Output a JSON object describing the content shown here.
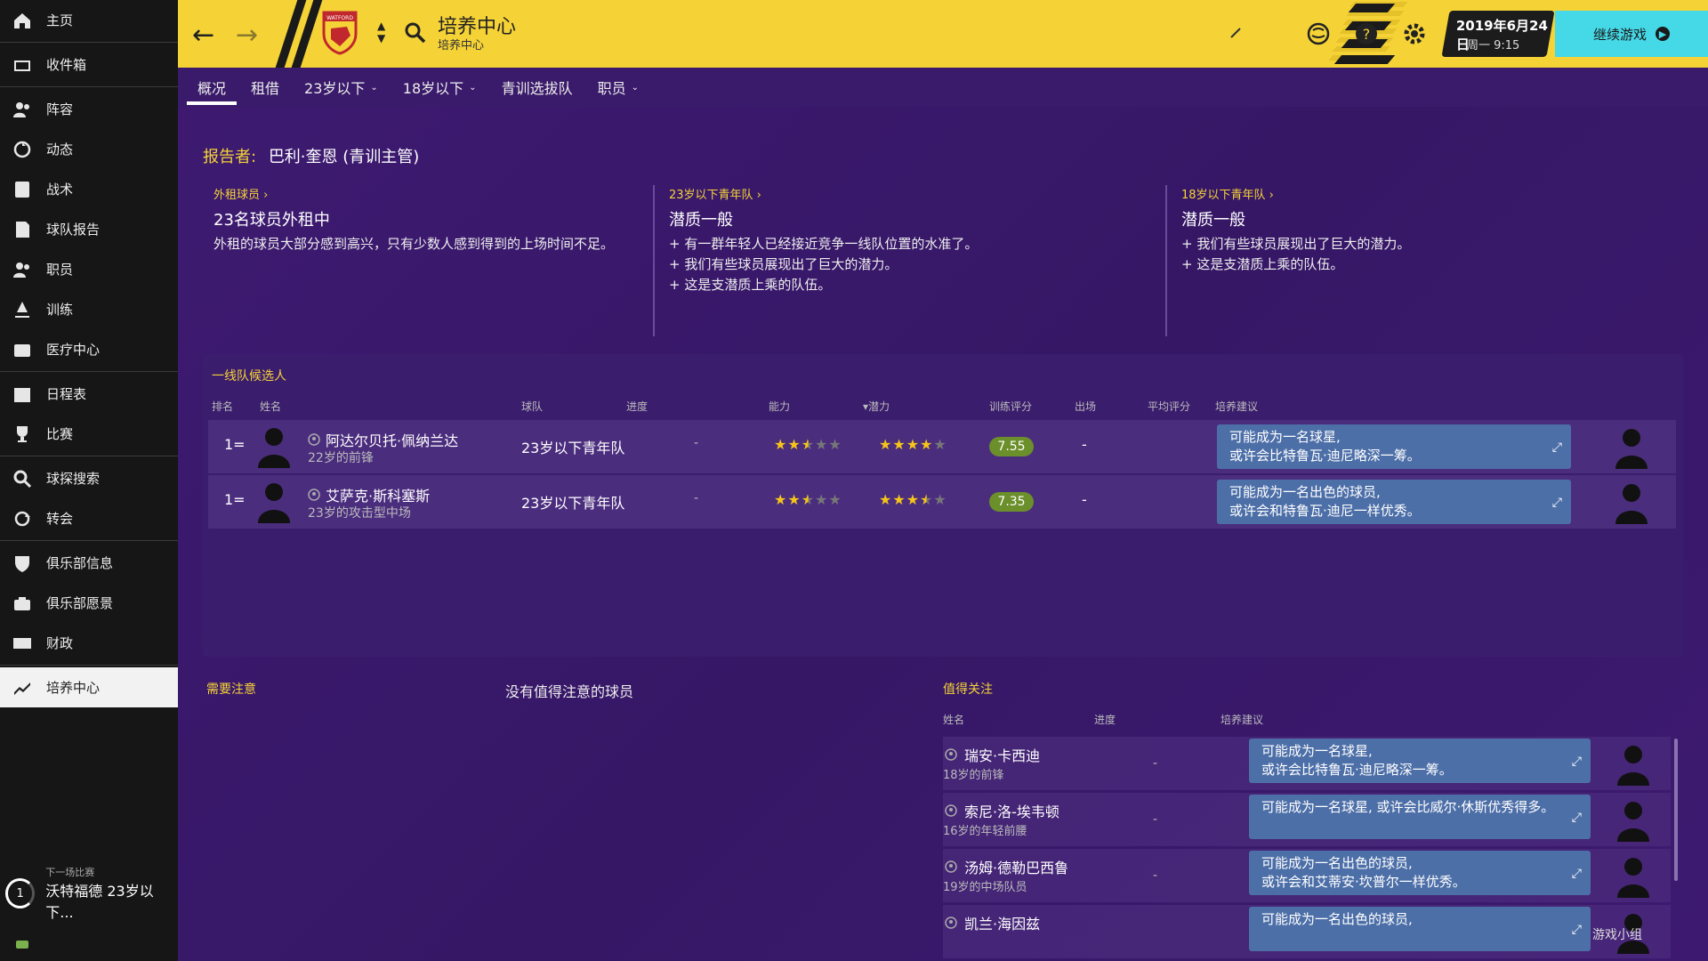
{
  "sidebar": {
    "items": [
      {
        "label": "主页",
        "icon": "home-icon"
      },
      {
        "label": "收件箱",
        "icon": "inbox-icon"
      },
      {
        "label": "阵容",
        "icon": "squad-icon"
      },
      {
        "label": "动态",
        "icon": "dynamics-icon"
      },
      {
        "label": "战术",
        "icon": "tactics-icon"
      },
      {
        "label": "球队报告",
        "icon": "report-icon"
      },
      {
        "label": "职员",
        "icon": "staff-icon"
      },
      {
        "label": "训练",
        "icon": "training-icon"
      },
      {
        "label": "医疗中心",
        "icon": "medical-icon"
      },
      {
        "label": "日程表",
        "icon": "calendar-icon"
      },
      {
        "label": "比赛",
        "icon": "trophy-icon"
      },
      {
        "label": "球探搜索",
        "icon": "search-icon"
      },
      {
        "label": "转会",
        "icon": "transfer-icon"
      },
      {
        "label": "俱乐部信息",
        "icon": "shield-icon"
      },
      {
        "label": "俱乐部愿景",
        "icon": "vision-icon"
      },
      {
        "label": "财政",
        "icon": "finance-icon"
      },
      {
        "label": "培养中心",
        "icon": "development-icon"
      }
    ],
    "next_match": {
      "label": "下一场比赛",
      "value": "沃特福德 23岁以下...",
      "count": "1"
    }
  },
  "topbar": {
    "title": "培养中心",
    "subtitle": "培养中心",
    "date": "2019年6月24日",
    "time": "周一 9:15",
    "continue_label": "继续游戏",
    "crest_text": "WATFORD"
  },
  "tabs": [
    {
      "label": "概况",
      "dropdown": false
    },
    {
      "label": "租借",
      "dropdown": false
    },
    {
      "label": "23岁以下",
      "dropdown": true
    },
    {
      "label": "18岁以下",
      "dropdown": true
    },
    {
      "label": "青训选拔队",
      "dropdown": false
    },
    {
      "label": "职员",
      "dropdown": true
    }
  ],
  "reporter": {
    "key": "报告者:",
    "name": "巴利·奎恩 (青训主管)"
  },
  "summaries": [
    {
      "link": "外租球员 ›",
      "head": "23名球员外租中",
      "lines": [
        "外租的球员大部分感到高兴，只有少数人感到得到的上场时间不足。"
      ]
    },
    {
      "link": "23岁以下青年队 ›",
      "head": "潜质一般",
      "lines": [
        "+ 有一群年轻人已经接近竞争一线队位置的水准了。",
        "+ 我们有些球员展现出了巨大的潜力。",
        "+ 这是支潜质上乘的队伍。"
      ]
    },
    {
      "link": "18岁以下青年队 ›",
      "head": "潜质一般",
      "lines": [
        "+ 我们有些球员展现出了巨大的潜力。",
        "+ 这是支潜质上乘的队伍。"
      ]
    }
  ],
  "candidates": {
    "title": "一线队候选人",
    "headers": [
      "排名",
      "姓名",
      "球队",
      "进度",
      "能力",
      "▾潜力",
      "训练评分",
      "出场",
      "平均评分",
      "培养建议"
    ],
    "rows": [
      {
        "rank": "1=",
        "name": "阿达尔贝托·佩纳兰达",
        "sub": "22岁的前锋",
        "team": "23岁以下青年队",
        "progress": "-",
        "ability": 2.5,
        "potential": 4,
        "rating": "7.55",
        "apps": "-",
        "advice1": "可能成为一名球星,",
        "advice2": "或许会比特鲁瓦·迪尼略深一筹。"
      },
      {
        "rank": "1=",
        "name": "艾萨克·斯科塞斯",
        "sub": "23岁的攻击型中场",
        "team": "23岁以下青年队",
        "progress": "-",
        "ability": 2.5,
        "potential": 3.5,
        "rating": "7.35",
        "apps": "-",
        "advice1": "可能成为一名出色的球员,",
        "advice2": "或许会和特鲁瓦·迪尼一样优秀。"
      }
    ]
  },
  "attention": {
    "title": "需要注意",
    "empty": "没有值得注意的球员"
  },
  "watch": {
    "title": "值得关注",
    "headers": [
      "姓名",
      "进度",
      "培养建议"
    ],
    "rows": [
      {
        "name": "瑞安·卡西迪",
        "sub": "18岁的前锋",
        "progress": "-",
        "advice1": "可能成为一名球星,",
        "advice2": "或许会比特鲁瓦·迪尼略深一筹。"
      },
      {
        "name": "索尼·洛-埃韦顿",
        "sub": "16岁的年轻前腰",
        "progress": "-",
        "advice1": "可能成为一名球星, 或许会比威尔·休斯优秀得多。",
        "advice2": ""
      },
      {
        "name": "汤姆·德勒巴西鲁",
        "sub": "19岁的中场队员",
        "progress": "-",
        "advice1": "可能成为一名出色的球员,",
        "advice2": "或许会和艾蒂安·坎普尔一样优秀。"
      },
      {
        "name": "凯兰·海因兹",
        "sub": "",
        "progress": "",
        "advice1": "可能成为一名出色的球员,",
        "advice2": ""
      }
    ]
  },
  "watermark": "游戏小组"
}
